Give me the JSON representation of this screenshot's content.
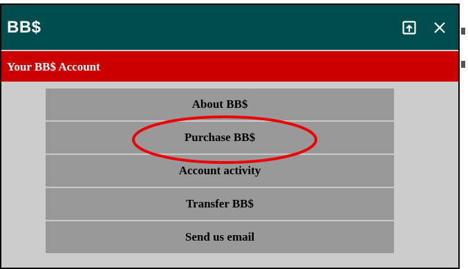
{
  "window": {
    "title": "BB$",
    "popout_icon": "popout-window-icon",
    "close_icon": "close-icon"
  },
  "header": {
    "title": "Your BB$ Account"
  },
  "menu": {
    "items": [
      {
        "label": "About BB$"
      },
      {
        "label": "Purchase BB$"
      },
      {
        "label": "Account activity"
      },
      {
        "label": "Transfer BB$"
      },
      {
        "label": "Send us email"
      }
    ]
  },
  "annotation": {
    "shape": "ellipse",
    "color": "#ee0000",
    "target": "Purchase BB$"
  },
  "colors": {
    "titlebar": "#004d4d",
    "header": "#cc0000",
    "panel": "#cccccc",
    "menu_item": "#999999"
  }
}
